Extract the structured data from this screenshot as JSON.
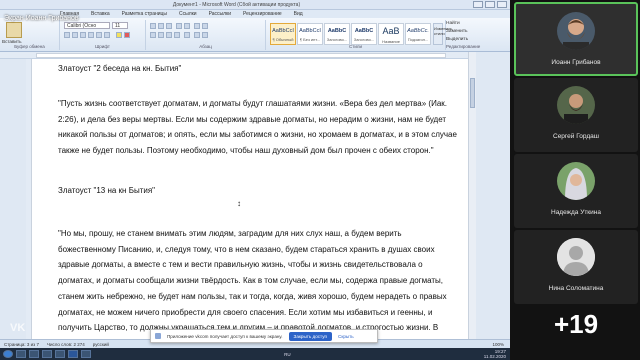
{
  "share": {
    "label": "Экран Иоанн Грибанов",
    "window_title": "Документ1 - Microsoft Word (Сбой активации продукта)",
    "ribbon_tabs": [
      "Главная",
      "Вставка",
      "Разметка страницы",
      "Ссылки",
      "Рассылки",
      "Рецензирование",
      "Вид"
    ],
    "clipboard": {
      "paste_label": "Вставить",
      "group": "Буфер обмена"
    },
    "font": {
      "family": "Calibri (Осно",
      "size": "11",
      "group": "Шрифт"
    },
    "paragraph_group": "Абзац",
    "styles": {
      "group": "Стили",
      "change_label": "Изменить стили",
      "items": [
        {
          "sample": "AaBbCcI",
          "name": "¶ Обычный",
          "active": true
        },
        {
          "sample": "AaBbCcI",
          "name": "¶ Без инт...",
          "active": false
        },
        {
          "sample": "AaBbC",
          "name": "Заголово...",
          "active": false
        },
        {
          "sample": "AaBbC",
          "name": "Заголово...",
          "active": false
        },
        {
          "sample": "AaB",
          "name": "Название",
          "active": false
        },
        {
          "sample": "AaBbCc.",
          "name": "Подзагол...",
          "active": false
        }
      ]
    },
    "editing": {
      "find": "Найти",
      "replace": "Заменить",
      "select": "Выделить",
      "group": "Редактирование"
    },
    "document": {
      "heading1": "Златоуст \"2 беседа на кн. Бытия\"",
      "para1": "\"Пусть жизнь соответствует догматам, и догматы будут глашатаями жизни. «Вера без дел мертва» (Иак. 2:26), и дела без веры мертвы. Если мы содержим здравые догматы, но нерадим о жизни, нам не будет никакой пользы от догматов; и опять, если мы заботимся о жизни, но хромаем в догматах, и в этом случае также не будет пользы. Поэтому необходимо, чтобы наш духовный дом был прочен с обеих сторон.\"",
      "heading2": "Златоуст \"13 на кн Бытия\"",
      "para2": "\"Но мы, прошу, не станем внимать этим людям, заградим для них слух наш, а будем верить божественному Писанию, и, следуя тому, что в нем сказано, будем стараться хранить в душах своих здравые догматы, а вместе с тем и вести правильную жизнь, чтобы и жизнь свидетельствовала о догматах, и догматы сообщали жизни твёрдость. Как в том случае, если мы, содержа правые догматы, станем жить небрежно, не будет нам пользы, так и тогда, когда, живя хорошо, будем нерадеть о правых догматах, не можем ничего приобрести для своего спасения. Если хотим мы избавиться и геенны, и получить Царство, то должны украшаться тем и другим – и правотой догматов, и строгостью жизни. В самом деле, что пользы, скажи мне, если дерево и"
    },
    "status": {
      "page": "Страница: 3 из 7",
      "words": "Число слов: 2 274",
      "lang": "русский",
      "zoom": "100%"
    },
    "notice": {
      "text": "Приложение vkcom получает доступ к вашему экрану.",
      "open_access": "Закрыть доступ",
      "hide": "Скрыть"
    },
    "taskbar": {
      "lang": "RU",
      "time": "19:27",
      "date": "11.02.2020"
    },
    "logo": "VK"
  },
  "participants": [
    {
      "name": "Иоанн Грибанов",
      "speaking": true,
      "avatar": "photo-bearded-man-icon"
    },
    {
      "name": "Сергей Гордаш",
      "speaking": false,
      "avatar": "photo-man-icon"
    },
    {
      "name": "Надежда Уткина",
      "speaking": false,
      "avatar": "photo-woman-icon"
    },
    {
      "name": "Нина Соломатина",
      "speaking": false,
      "avatar": "default-user-icon"
    }
  ],
  "more_participants": "+19"
}
